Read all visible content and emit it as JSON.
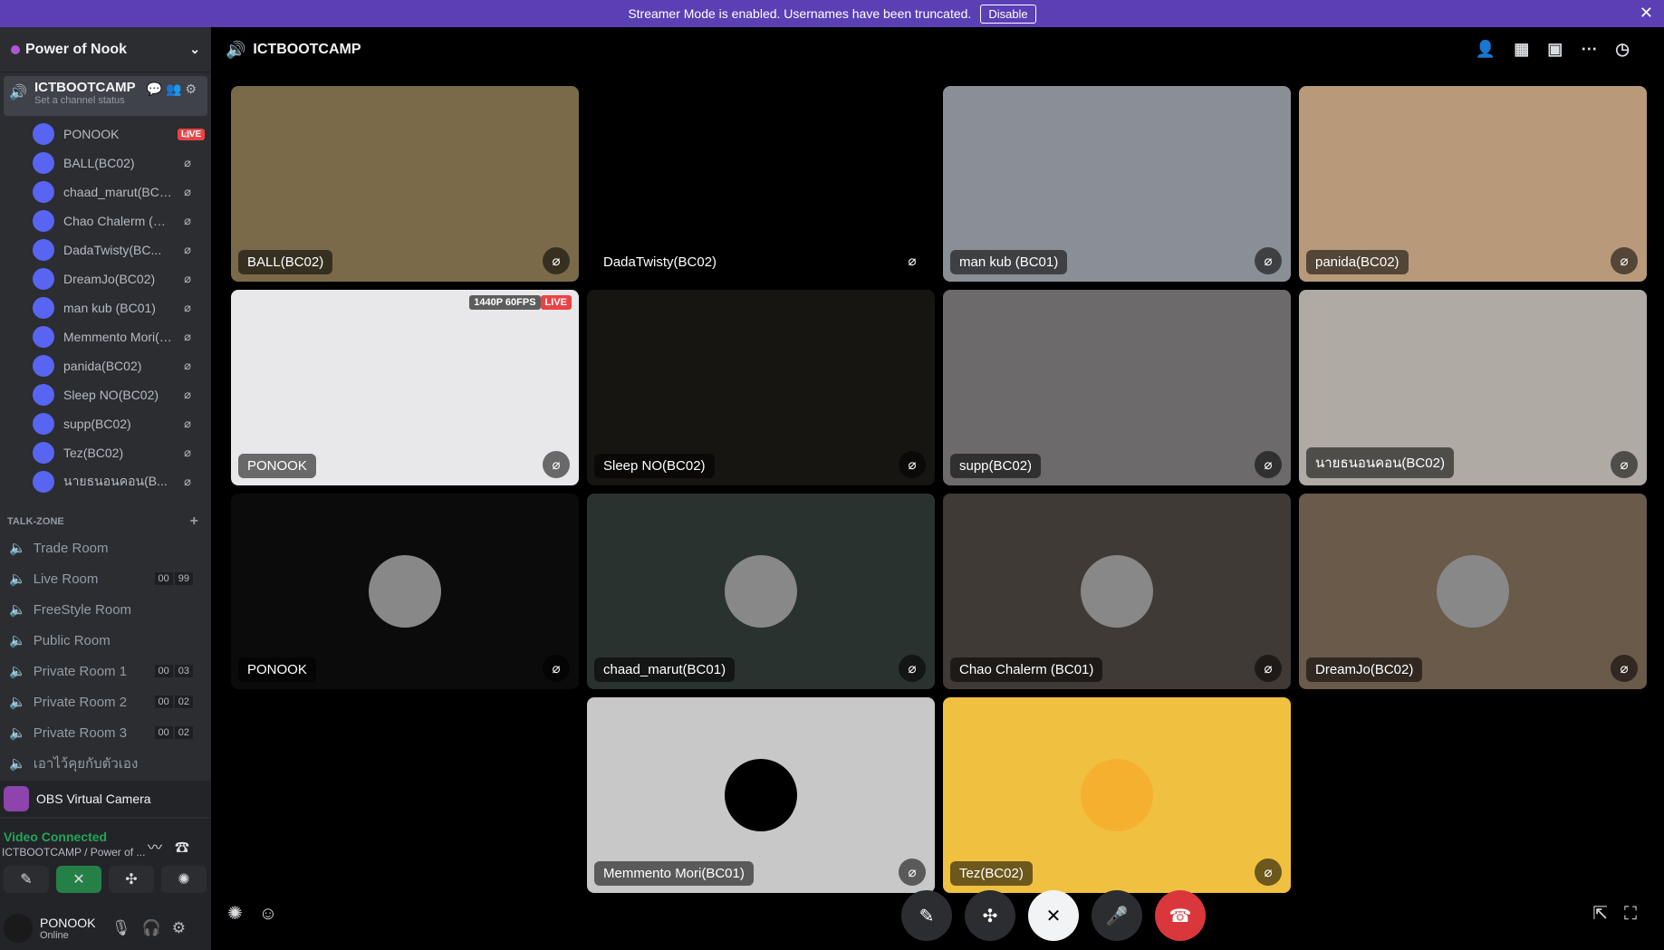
{
  "banner": {
    "text": "Streamer Mode is enabled. Usernames have been truncated.",
    "button": "Disable",
    "close": "✕"
  },
  "sidebar": {
    "server": "Power of Nook",
    "channel": {
      "name": "ICTBOOTCAMP",
      "status": "Set a channel status"
    },
    "members": [
      {
        "name": "PONOOK",
        "live": "LIVE"
      },
      {
        "name": "BALL(BC02)"
      },
      {
        "name": "chaad_marut(BC01)"
      },
      {
        "name": "Chao Chalerm (BC..."
      },
      {
        "name": "DadaTwisty(BC..."
      },
      {
        "name": "DreamJo(BC02)"
      },
      {
        "name": "man kub (BC01)"
      },
      {
        "name": "Memmento Mori(B..."
      },
      {
        "name": "panida(BC02)"
      },
      {
        "name": "Sleep NO(BC02)"
      },
      {
        "name": "supp(BC02)"
      },
      {
        "name": "Tez(BC02)"
      },
      {
        "name": "นายธนอนคอน(B..."
      }
    ],
    "category": "TALK-ZONE",
    "rooms": [
      {
        "name": "Trade Room"
      },
      {
        "name": "Live Room",
        "c1": "00",
        "c2": "99"
      },
      {
        "name": "FreeStyle Room"
      },
      {
        "name": "Public Room"
      },
      {
        "name": "Private Room 1",
        "c1": "00",
        "c2": "03"
      },
      {
        "name": "Private Room 2",
        "c1": "00",
        "c2": "02"
      },
      {
        "name": "Private Room 3",
        "c1": "00",
        "c2": "02"
      },
      {
        "name": "เอาไว้คุยกับตัวเอง"
      }
    ],
    "obs": "OBS Virtual Camera",
    "voice": {
      "status": "Video Connected",
      "path": "ICTBOOTCAMP / Power of ..."
    },
    "user": {
      "name": "PONOOK",
      "status": "Online"
    }
  },
  "header": {
    "title": "ICTBOOTCAMP"
  },
  "tiles": [
    {
      "label": "BALL(BC02)",
      "bg": "#7a6a4a"
    },
    {
      "label": "DadaTwisty(BC02)",
      "bg": "#000000"
    },
    {
      "label": "man kub (BC01)",
      "bg": "#8a8f96"
    },
    {
      "label": "panida(BC02)",
      "bg": "#b89a7a"
    },
    {
      "label": "PONOOK",
      "bg": "#e8e8ea",
      "badge": "1440P 60FPS",
      "live": "LIVE"
    },
    {
      "label": "Sleep NO(BC02)",
      "bg": "#171512"
    },
    {
      "label": "supp(BC02)",
      "bg": "#6c6a6a"
    },
    {
      "label": "นายธนอนคอน(BC02)",
      "bg": "#b0aaa4"
    },
    {
      "label": "PONOOK",
      "bg": "#0b0b0c"
    },
    {
      "label": "chaad_marut(BC01)",
      "bg": "#2a3230"
    },
    {
      "label": "Chao Chalerm (BC01)",
      "bg": "#403a36"
    },
    {
      "label": "DreamJo(BC02)",
      "bg": "#6a5a4a"
    },
    {
      "label": "Memmento Mori(BC01)",
      "bg": "#c8c8c8"
    },
    {
      "label": "Tez(BC02)",
      "bg": "#f0c040"
    }
  ]
}
